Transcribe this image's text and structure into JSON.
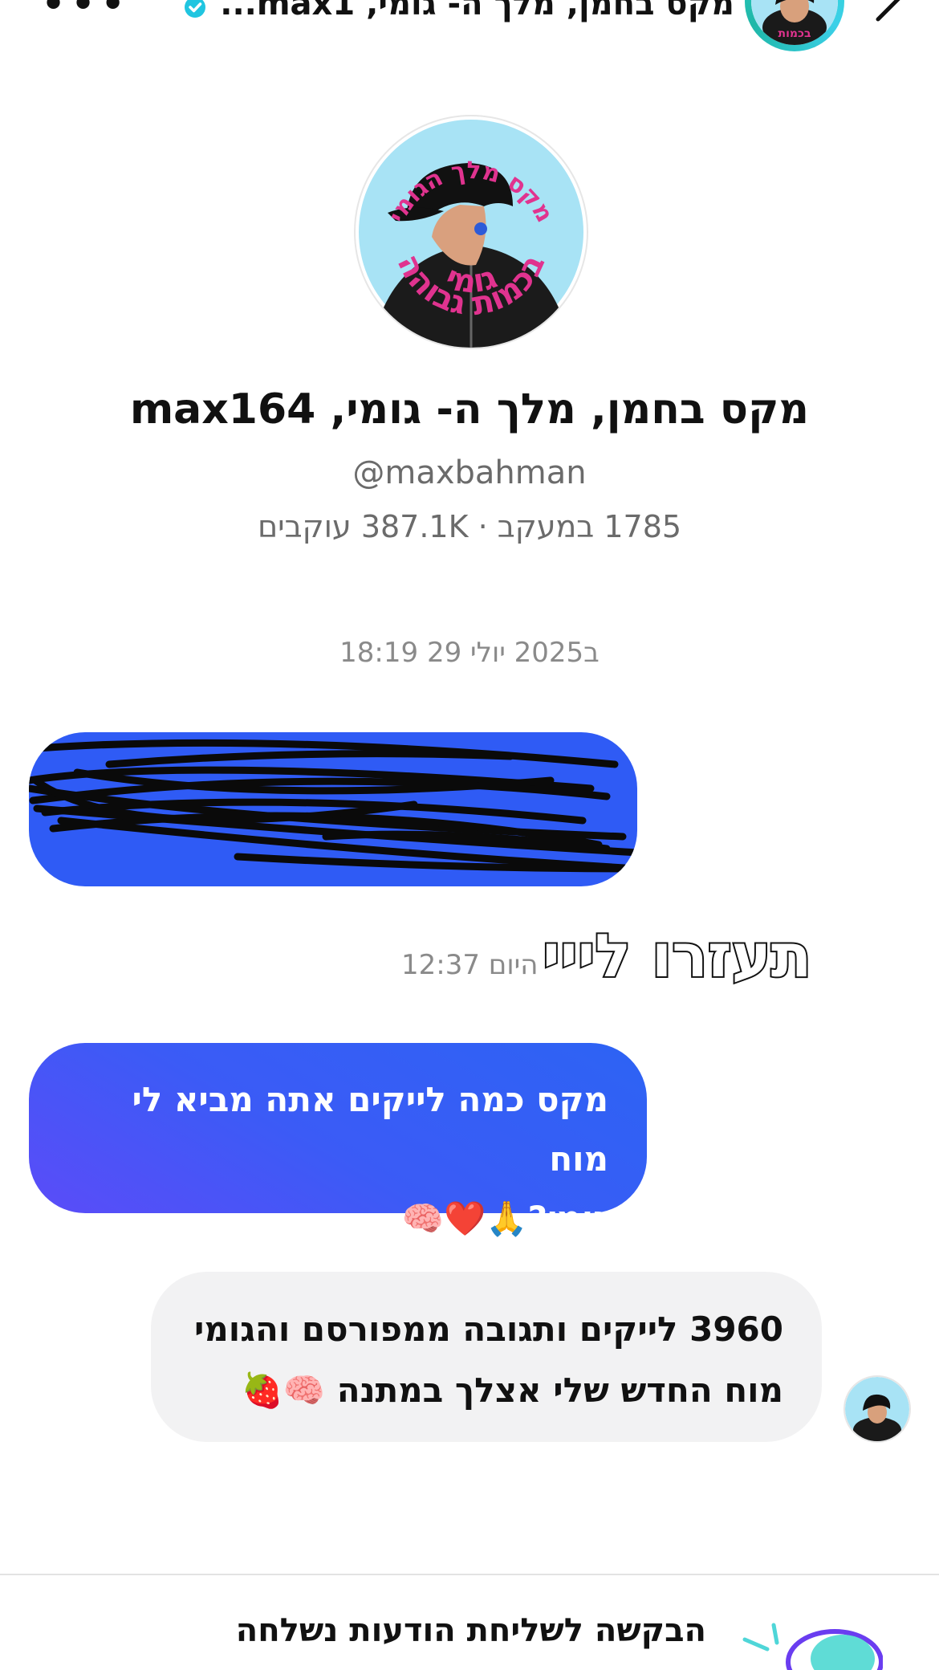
{
  "header": {
    "title": "מקס בחמן, מלך ה- גומי, max1...",
    "more_icon": "more-horizontal-icon",
    "back_icon": "chevron-back-icon",
    "verified_icon": "verified-badge-icon"
  },
  "profile": {
    "avatar_text_top": "מקס מלך הגומי",
    "avatar_text_bottom_1": "גומי",
    "avatar_text_bottom_2": "בכמות גבוהה",
    "name": "מקס בחמן, מלך ה- גומי, max164",
    "handle": "@maxbahman",
    "stats": "1785 במעקב · 387.1K עוקבים"
  },
  "conversation": {
    "date_label": "ב2025 יולי 29 18:19",
    "messages": [
      {
        "direction": "outgoing",
        "text": "",
        "redacted": true
      },
      {
        "direction": "outgoing",
        "type": "sticker",
        "text": "תעזרו לייי",
        "time": "היום 12:37"
      },
      {
        "direction": "outgoing",
        "text_line_1": "מקס כמה לייקים אתה מביא לי מוח",
        "text_line_2": "גומי?🙏❤️🧠"
      },
      {
        "direction": "incoming",
        "text_line_1": "3960 לייקים ותגובה ממפורסם והגומי",
        "text_line_2": "מוח החדש שלי אצלך במתנה 🧠🍓"
      }
    ]
  },
  "footer": {
    "notice": "הבקשה לשליחת הודעות נשלחה"
  },
  "colors": {
    "outgoing_bubble": "#2f5bf5",
    "incoming_bubble": "#f2f2f3",
    "secondary_text": "#6b6b6b",
    "avatar_background": "#a8e3f5",
    "avatar_text": "#e0338f"
  }
}
